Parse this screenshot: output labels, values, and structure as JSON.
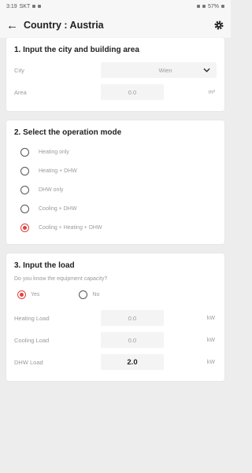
{
  "statusbar": {
    "time": "3:19",
    "indicators": "SKT",
    "battery": "57%"
  },
  "header": {
    "title": "Country : Austria"
  },
  "section1": {
    "title": "1. Input the city and building area",
    "city_label": "City",
    "city_value": "Wien",
    "area_label": "Area",
    "area_value": "0.0",
    "area_unit": "m²"
  },
  "section2": {
    "title": "2. Select the operation mode",
    "options": [
      {
        "label": "Heating only",
        "selected": false
      },
      {
        "label": "Heating + DHW",
        "selected": false
      },
      {
        "label": "DHW only",
        "selected": false
      },
      {
        "label": "Cooling + DHW",
        "selected": false
      },
      {
        "label": "Cooling + Heating + DHW",
        "selected": true
      }
    ]
  },
  "section3": {
    "title": "3. Input the load",
    "question": "Do you know the equipment capacity?",
    "yes_label": "Yes",
    "no_label": "No",
    "selected": "Yes",
    "loads": [
      {
        "label": "Heating Load",
        "value": "0.0",
        "unit": "kW"
      },
      {
        "label": "Cooling Load",
        "value": "0.0",
        "unit": "kW"
      },
      {
        "label": "DHW Load",
        "value": "2.0",
        "unit": "kW"
      }
    ]
  },
  "colors": {
    "accent": "#e0413f",
    "background": "#ededed",
    "card": "#ffffff"
  }
}
